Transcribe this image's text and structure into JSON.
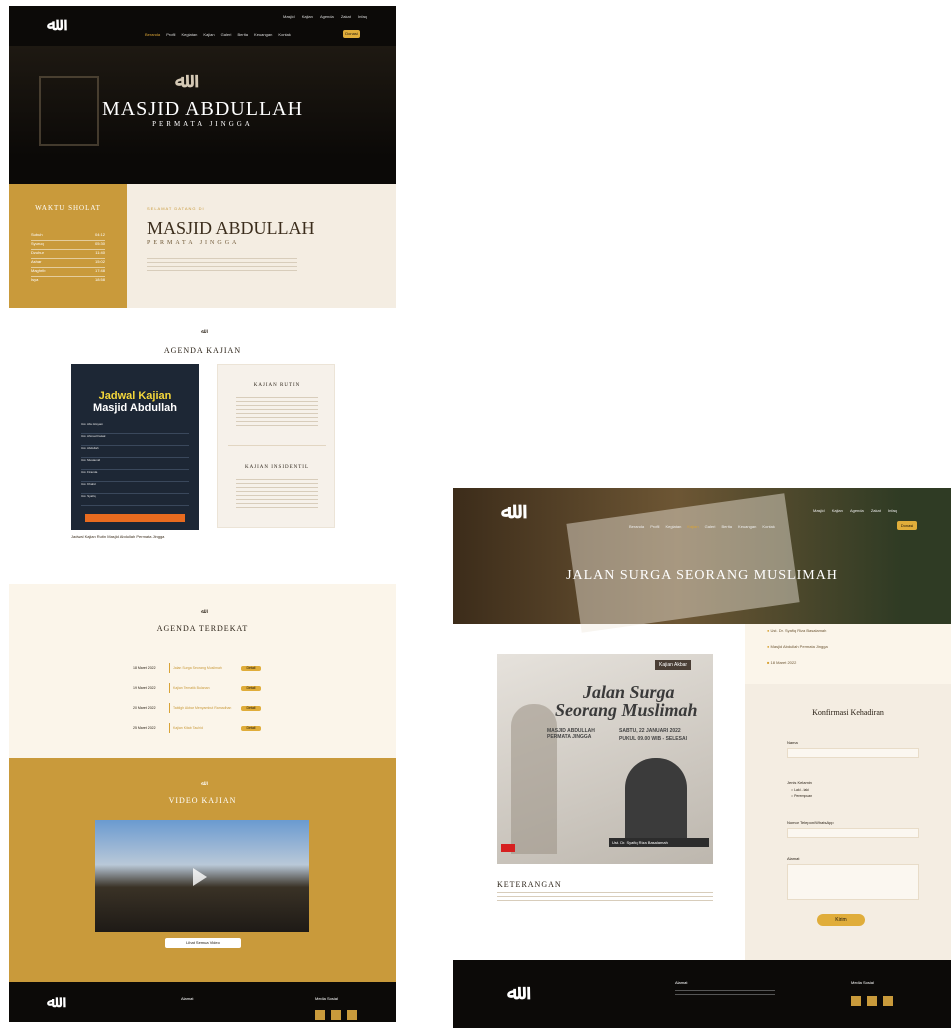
{
  "left": {
    "top_links": [
      "Masjid",
      "Kajian",
      "Agenda",
      "Zakat",
      "Infaq"
    ],
    "nav": [
      "Beranda",
      "Profil",
      "Kegiatan",
      "Kajian",
      "Galeri",
      "Berita",
      "Keuangan",
      "Kontak",
      "Donasi"
    ],
    "nav_button": "Donasi",
    "hero_title": "MASJID ABDULLAH",
    "hero_subtitle": "PERMATA JINGGA",
    "prayer_title": "Waktu Sholat",
    "prayer_rows": [
      {
        "name": "Subuh",
        "time": "04:12"
      },
      {
        "name": "Syuruq",
        "time": "05:30"
      },
      {
        "name": "Dzuhur",
        "time": "11:40"
      },
      {
        "name": "Ashar",
        "time": "15:02"
      },
      {
        "name": "Maghrib",
        "time": "17:48"
      },
      {
        "name": "Isya",
        "time": "18:58"
      }
    ],
    "about_kicker": "Selamat Datang di",
    "about_title": "MASJID ABDULLAH",
    "about_subtitle": "PERMATA JINGGA",
    "agenda_heading": "AGENDA KAJIAN",
    "schedule_title_1": "Jadwal Kajian",
    "schedule_title_2": "Masjid Abdullah",
    "schedule_rows": [
      "Ust. Abu Hisyam",
      "Ust. Ahmad Faisal",
      "Ust. Abdullah",
      "Ust. Mustamid",
      "Ust. Firanda",
      "Ust. Khalid",
      "Ust. Syafiq"
    ],
    "kajian_rutin_title": "Kajian Rutin",
    "kajian_insidentil_title": "Kajian Insidentil",
    "poster_caption": "Jadwal Kajian Rutin Masjid Abdullah Permata Jingga",
    "nearest_heading": "AGENDA TERDEKAT",
    "nearest_items": [
      {
        "date": "18 Maret 2022",
        "title": "Jalan Surga Seorang Muslimah",
        "btn": "Detail"
      },
      {
        "date": "19 Maret 2022",
        "title": "Kajian Tematik Bulanan",
        "btn": "Detail"
      },
      {
        "date": "20 Maret 2022",
        "title": "Tabligh Akbar Menyambut Ramadhan",
        "btn": "Detail"
      },
      {
        "date": "25 Maret 2022",
        "title": "Kajian Kitab Tauhid",
        "btn": "Detail"
      }
    ],
    "video_heading": "VIDEO KAJIAN",
    "video_button": "Lihat Semua Video"
  },
  "right": {
    "top_links": [
      "Masjid",
      "Kajian",
      "Agenda",
      "Zakat",
      "Infaq"
    ],
    "nav": [
      "Beranda",
      "Profil",
      "Kegiatan",
      "Kajian",
      "Galeri",
      "Berita",
      "Keuangan",
      "Kontak"
    ],
    "nav_button": "Donasi",
    "hero_title": "JALAN SURGA SEORANG MUSLIMAH",
    "poster_tag": "Kajian Akbar",
    "poster_title_1": "Jalan Surga",
    "poster_title_2": "Seorang Muslimah",
    "poster_venue": "MASJID ABDULLAH PERMATA JINGGA",
    "poster_date": "SABTU, 22 JANUARI 2022",
    "poster_time": "PUKUL 09.00 WIB - SELESAI",
    "poster_speaker": "Ust. Dr. Syafiq Riza Basalamah",
    "info_speaker": "Ust. Dr. Syafiq Riza Basalamah",
    "info_place": "Masjid Abdullah Permata Jingga",
    "info_date": "18 Maret 2022",
    "form_title": "Konfirmasi Kehadiran",
    "form_name_label": "Nama",
    "form_gender_label": "Jenis Kelamin",
    "form_gender_opts": [
      "Laki - laki",
      "Perempuan"
    ],
    "form_phone_label": "Nomor Telepon/WhatsApp",
    "form_address_label": "Alamat",
    "form_submit": "Kirim",
    "desc_title": "Keterangan",
    "footer_address_label": "Alamat",
    "footer_social_label": "Media Sosial"
  },
  "footer_left": {
    "address_label": "Alamat",
    "social_label": "Media Sosial"
  },
  "colors": {
    "gold": "#d9a336",
    "dark": "#0c0a08",
    "cream": "#fbf5ea"
  }
}
